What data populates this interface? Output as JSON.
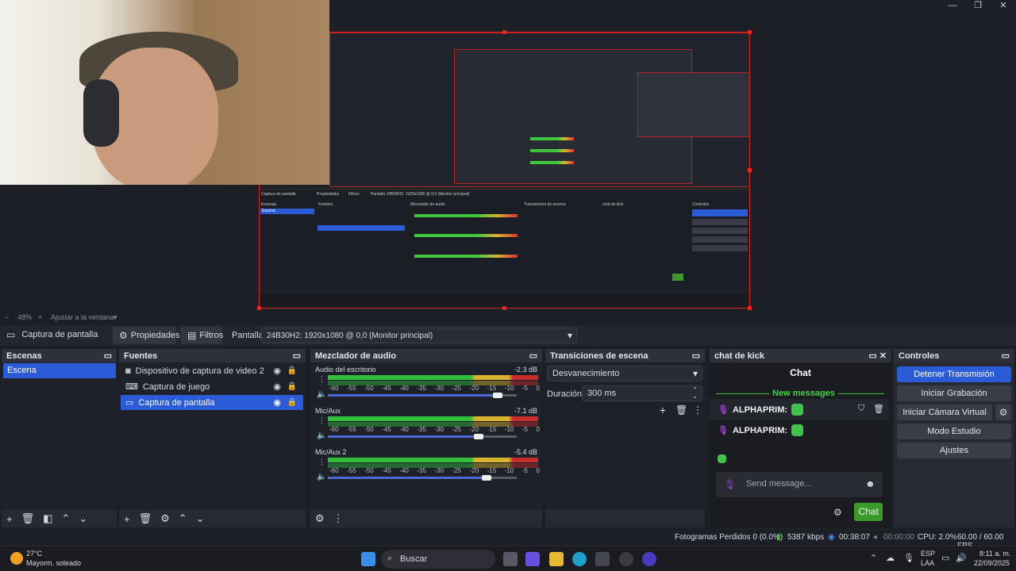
{
  "window_controls": {
    "minimize": "—",
    "maximize": "❐",
    "close": "✕"
  },
  "preview": {
    "mini_labels": {
      "src": "Captura de pantalla",
      "props": "Propiedades",
      "filters": "Filtros",
      "display": "Pantalla",
      "display_val": "24B30H2: 1920x1080 @ 0,0 (Monitor principal)",
      "scenes": "Escenas",
      "scene": "Escena",
      "sources": "Fuentes",
      "mixer": "Mezclador de audio",
      "transitions": "Transiciones de escena",
      "chat": "chat de kick",
      "controls": "Controles"
    }
  },
  "zoom": {
    "minus": "−",
    "value": "48%",
    "plus": "+",
    "fit": "Ajustar a la ventana"
  },
  "context": {
    "source_label": "Captura de pantalla",
    "properties": "Propiedades",
    "filters": "Filtros",
    "display_label": "Pantalla",
    "display_value": "24B30H2: 1920x1080 @ 0,0 (Monitor principal)"
  },
  "scenes": {
    "title": "Escenas",
    "items": [
      "Escena"
    ]
  },
  "sources": {
    "title": "Fuentes",
    "items": [
      {
        "label": "Dispositivo de captura de video 2",
        "icon": "camera-icon"
      },
      {
        "label": "Captura de juego",
        "icon": "gamepad-icon"
      },
      {
        "label": "Captura de pantalla",
        "icon": "monitor-icon"
      }
    ]
  },
  "mixer": {
    "title": "Mezclador de audio",
    "channels": [
      {
        "name": "Audio del escritorio",
        "db": "-2.3 dB",
        "level": 0.9
      },
      {
        "name": "Mic/Aux",
        "db": "-7.1 dB",
        "level": 0.8
      },
      {
        "name": "Mic/Aux 2",
        "db": "-5.4 dB",
        "level": 0.84
      }
    ],
    "ticks": [
      "-60",
      "-55",
      "-50",
      "-45",
      "-40",
      "-35",
      "-30",
      "-25",
      "-20",
      "-15",
      "-10",
      "-5",
      "0"
    ]
  },
  "transitions": {
    "title": "Transiciones de escena",
    "selected": "Desvanecimiento",
    "duration_label": "Duración",
    "duration_value": "300 ms"
  },
  "chat": {
    "dock_title": "chat de kick",
    "title": "Chat",
    "new_messages": "New messages",
    "messages": [
      {
        "user": "ALPHAPRIM:"
      },
      {
        "user": "ALPHAPRIM:"
      }
    ],
    "placeholder": "Send message...",
    "send": "Chat"
  },
  "controls": {
    "title": "Controles",
    "buttons": [
      "Detener Transmisión",
      "Iniciar Grabación",
      "Iniciar Cámara Virtual",
      "Modo Estudio",
      "Ajustes"
    ]
  },
  "status": {
    "dropped": "Fotogramas Perdidos 0 (0.0%)",
    "bitrate": "5387 kbps",
    "stream_time": "00:38:07",
    "rec_time": "00:00:00",
    "cpu": "CPU: 2.0%",
    "fps": "60.00 / 60.00 FPS"
  },
  "taskbar": {
    "weather_temp": "27°C",
    "weather_desc": "Mayorm. soleado",
    "search": "Buscar",
    "lang": "ESP",
    "lang2": "LAA",
    "time": "8:11 a. m.",
    "date": "22/09/2025"
  },
  "colors": {
    "accent": "#2c5bd8",
    "chat_send": "#3c9a2a",
    "record_red": "#d22"
  }
}
